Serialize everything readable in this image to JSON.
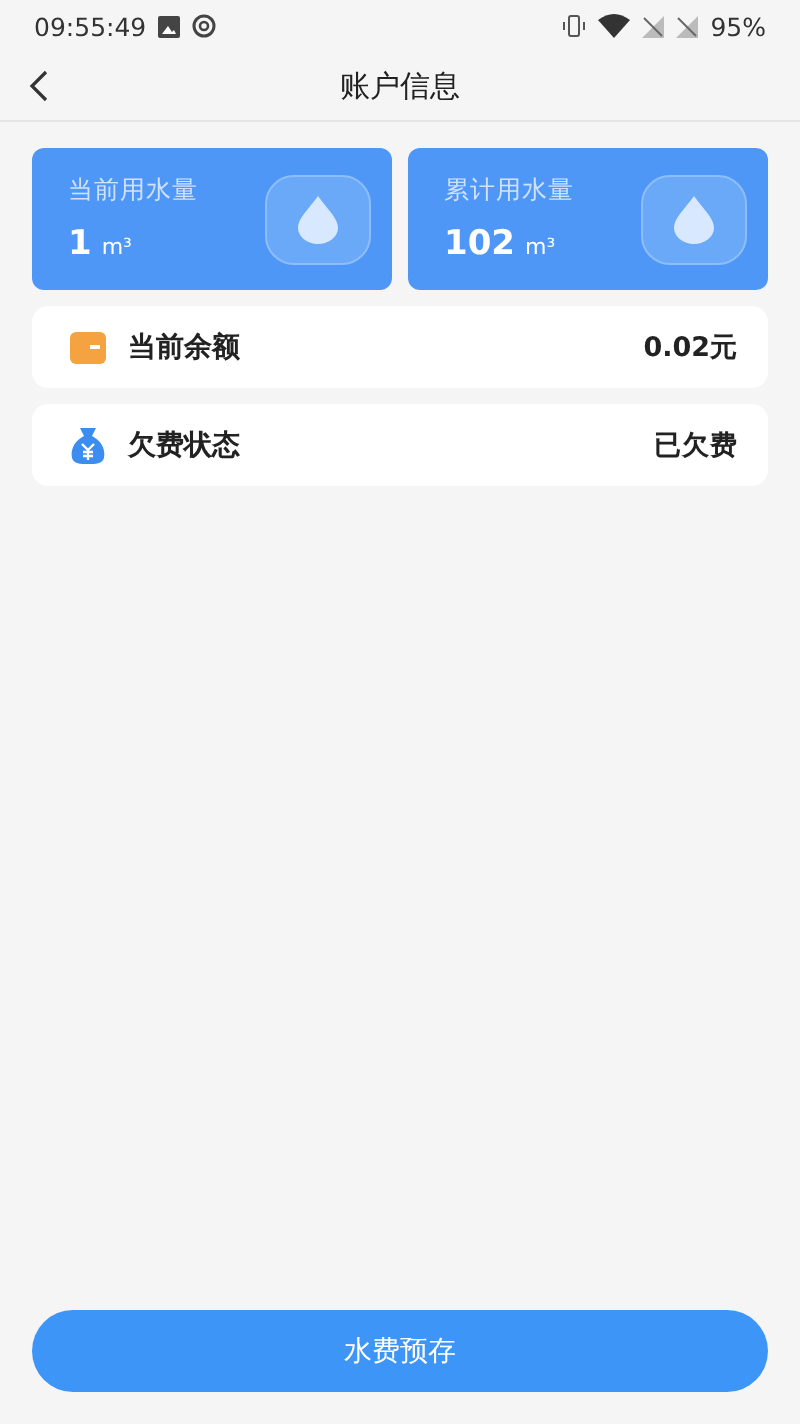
{
  "status_bar": {
    "time": "09:55:49",
    "battery": "95%"
  },
  "header": {
    "title": "账户信息"
  },
  "usage_cards": [
    {
      "label": "当前用水量",
      "value": "1",
      "unit": "m³"
    },
    {
      "label": "累计用水量",
      "value": "102",
      "unit": "m³"
    }
  ],
  "info_rows": [
    {
      "kind": "wallet",
      "label": "当前余额",
      "value": "0.02元"
    },
    {
      "kind": "money-bag",
      "label": "欠费状态",
      "value": "已欠费"
    }
  ],
  "button": {
    "label": "水费预存"
  }
}
